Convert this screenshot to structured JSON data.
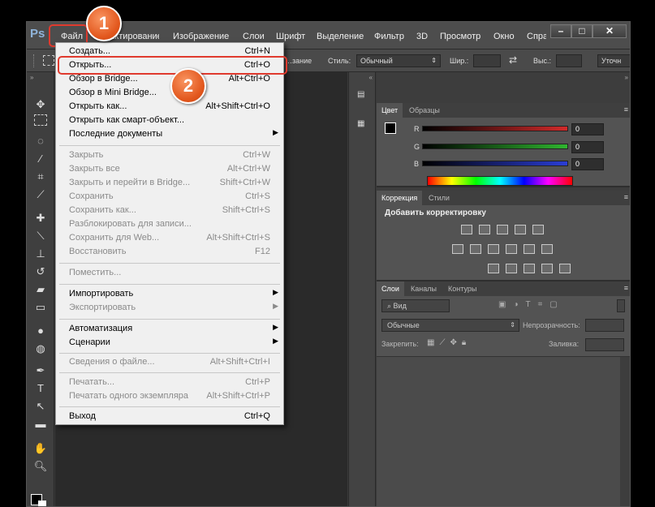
{
  "app": {
    "logo": "Ps",
    "menu": [
      "Файл",
      "Редактирование",
      "Изображение",
      "Слои",
      "Шрифт",
      "Выделение",
      "Фильтр",
      "3D",
      "Просмотр",
      "Окно",
      "Справка"
    ],
    "window_buttons": [
      "–",
      "□",
      "✕"
    ]
  },
  "options_bar": {
    "mode_label": "Стиль:",
    "mode_value": "Обычный",
    "prefix_label": "…зание",
    "width_label": "Шир.:",
    "height_label": "Выс.:",
    "refine_button": "Уточн"
  },
  "file_menu": {
    "items": [
      {
        "label": "Создать...",
        "shortcut": "Ctrl+N",
        "disabled": false
      },
      {
        "label": "Открыть...",
        "shortcut": "Ctrl+O",
        "disabled": false
      },
      {
        "label": "Обзор в Bridge...",
        "shortcut": "Alt+Ctrl+O",
        "disabled": false
      },
      {
        "label": "Обзор в Mini Bridge...",
        "shortcut": "",
        "disabled": false
      },
      {
        "label": "Открыть как...",
        "shortcut": "Alt+Shift+Ctrl+O",
        "disabled": false
      },
      {
        "label": "Открыть как смарт-объект...",
        "shortcut": "",
        "disabled": false
      },
      {
        "label": "Последние документы",
        "shortcut": "",
        "disabled": false,
        "submenu": true
      },
      {
        "label": "Закрыть",
        "shortcut": "Ctrl+W",
        "disabled": true
      },
      {
        "label": "Закрыть все",
        "shortcut": "Alt+Ctrl+W",
        "disabled": true
      },
      {
        "label": "Закрыть и перейти в Bridge...",
        "shortcut": "Shift+Ctrl+W",
        "disabled": true
      },
      {
        "label": "Сохранить",
        "shortcut": "Ctrl+S",
        "disabled": true
      },
      {
        "label": "Сохранить как...",
        "shortcut": "Shift+Ctrl+S",
        "disabled": true
      },
      {
        "label": "Разблокировать для записи...",
        "shortcut": "",
        "disabled": true
      },
      {
        "label": "Сохранить для Web...",
        "shortcut": "Alt+Shift+Ctrl+S",
        "disabled": true
      },
      {
        "label": "Восстановить",
        "shortcut": "F12",
        "disabled": true
      },
      {
        "label": "Поместить...",
        "shortcut": "",
        "disabled": true
      },
      {
        "label": "Импортировать",
        "shortcut": "",
        "disabled": false,
        "submenu": true
      },
      {
        "label": "Экспортировать",
        "shortcut": "",
        "disabled": true,
        "submenu": true
      },
      {
        "label": "Автоматизация",
        "shortcut": "",
        "disabled": false,
        "submenu": true
      },
      {
        "label": "Сценарии",
        "shortcut": "",
        "disabled": false,
        "submenu": true
      },
      {
        "label": "Сведения о файле...",
        "shortcut": "Alt+Shift+Ctrl+I",
        "disabled": true
      },
      {
        "label": "Печатать...",
        "shortcut": "Ctrl+P",
        "disabled": true
      },
      {
        "label": "Печатать одного экземпляра",
        "shortcut": "Alt+Shift+Ctrl+P",
        "disabled": true
      },
      {
        "label": "Выход",
        "shortcut": "Ctrl+Q",
        "disabled": false
      }
    ]
  },
  "color_panel": {
    "tabs": [
      "Цвет",
      "Образцы"
    ],
    "channels": [
      {
        "label": "R",
        "value": "0",
        "color": "#d22a2a"
      },
      {
        "label": "G",
        "value": "0",
        "color": "#2fb52f"
      },
      {
        "label": "B",
        "value": "0",
        "color": "#2a3dd6"
      }
    ]
  },
  "adjustments_panel": {
    "tabs": [
      "Коррекция",
      "Стили"
    ],
    "heading": "Добавить корректировку"
  },
  "layers_panel": {
    "tabs": [
      "Слои",
      "Каналы",
      "Контуры"
    ],
    "filter_label": "Вид",
    "blend_mode": "Обычные",
    "opacity_label": "Непрозрачность:",
    "lock_label": "Закрепить:",
    "fill_label": "Заливка:"
  },
  "annotations": {
    "badge1": "1",
    "badge2": "2"
  }
}
